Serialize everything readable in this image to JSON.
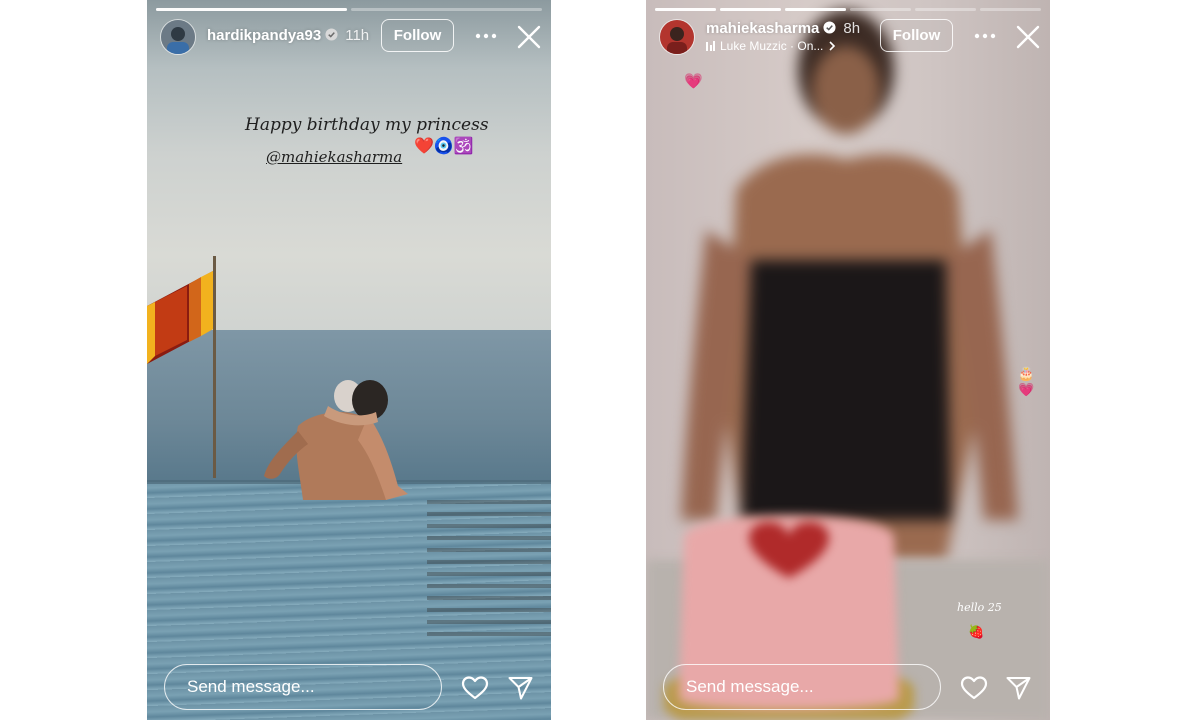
{
  "story_left": {
    "username": "hardikpandya93",
    "time": "11h",
    "follow_label": "Follow",
    "caption": "Happy birthday my princess",
    "mention": "@mahiekasharma",
    "emojis": "❤️🧿🕉️",
    "progress": [
      1.0,
      0.0
    ],
    "send_placeholder": "Send message...",
    "icons": [
      "verified-icon",
      "more-icon",
      "close-icon",
      "heart-icon",
      "share-icon"
    ]
  },
  "story_right": {
    "username": "mahiekasharma",
    "time": "8h",
    "music": "Luke Muzzic · On...",
    "follow_label": "Follow",
    "stickers": {
      "heart": "💗",
      "cake_heart": "🎂💗",
      "hello": "hello 25",
      "strawberry": "🍓"
    },
    "progress": [
      1.0,
      1.0,
      1.0,
      0.0,
      0.0,
      0.0
    ],
    "send_placeholder": "Send message...",
    "icons": [
      "verified-icon",
      "music-icon",
      "chevron-right-icon",
      "more-icon",
      "close-icon",
      "heart-icon",
      "share-icon"
    ]
  },
  "colors": {
    "ui_text": "#ffffff",
    "verified_blue": "#3797f0"
  }
}
